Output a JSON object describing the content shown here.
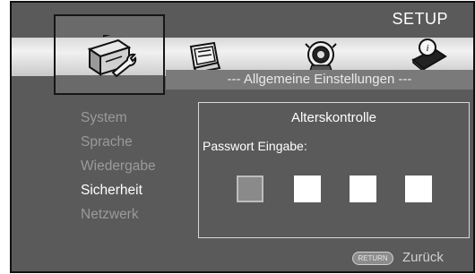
{
  "header": {
    "title": "SETUP"
  },
  "section": {
    "subtitle": "--- Allgemeine Einstellungen ---"
  },
  "tabs": [
    {
      "name": "general-settings",
      "icon": "toolbox-icon",
      "selected": true
    },
    {
      "name": "display-settings",
      "icon": "monitor-icon",
      "selected": false
    },
    {
      "name": "audio-settings",
      "icon": "speaker-icon",
      "selected": false
    },
    {
      "name": "information",
      "icon": "info-icon",
      "selected": false
    }
  ],
  "sidebar": {
    "items": [
      {
        "label": "System",
        "active": false
      },
      {
        "label": "Sprache",
        "active": false
      },
      {
        "label": "Wiedergabe",
        "active": false
      },
      {
        "label": "Sicherheit",
        "active": true
      },
      {
        "label": "Netzwerk",
        "active": false
      }
    ]
  },
  "panel": {
    "title": "Alterskontrolle",
    "label": "Passwort Eingabe:",
    "password_digits": 4,
    "active_digit": 1
  },
  "footer": {
    "return_button": "RETURN",
    "return_label": "Zurück"
  },
  "colors": {
    "background": "#5a5a5a",
    "band": "#e6e6e6",
    "text_active": "#ffffff",
    "text_inactive": "#9a9a9a"
  }
}
